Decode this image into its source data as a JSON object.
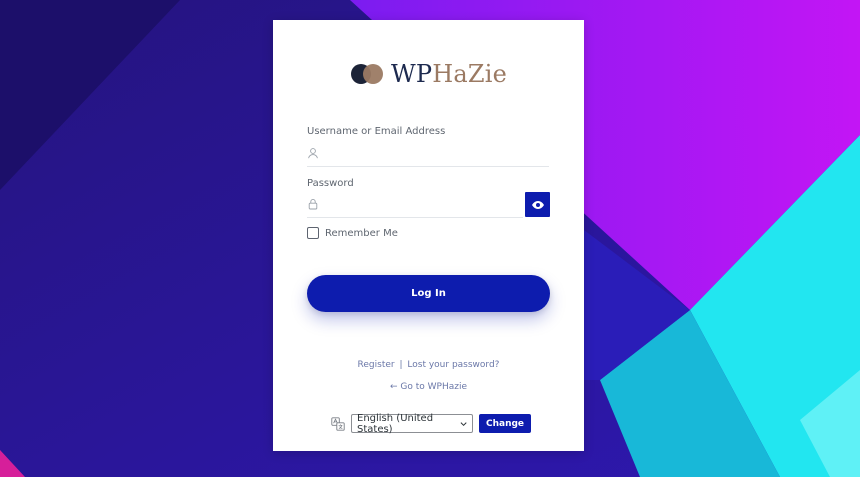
{
  "brand": {
    "logo_word_part1": "WP",
    "logo_word_part2": "HaZie",
    "logo_icon": "two-overlapping-circles-logo-icon"
  },
  "form": {
    "username_label": "Username or Email Address",
    "username_value": "",
    "username_icon": "user-icon",
    "password_label": "Password",
    "password_value": "",
    "password_icon": "lock-icon",
    "show_password_icon": "eye-icon",
    "remember_label": "Remember Me",
    "remember_checked": false,
    "login_label": "Log In"
  },
  "links": {
    "register": "Register",
    "separator": "|",
    "lost_password": "Lost your password?",
    "go_to_site": "← Go to WPHazie"
  },
  "language": {
    "icon": "translate-icon",
    "selected": "English (United States)",
    "change_label": "Change"
  },
  "colors": {
    "accent": "#0d1cae",
    "logo_dark": "#1d2a4f",
    "logo_brown": "#9b7a63",
    "bg_purple": "#2a139c",
    "bg_magenta": "#b412f2",
    "bg_cyan": "#22e6f0"
  }
}
